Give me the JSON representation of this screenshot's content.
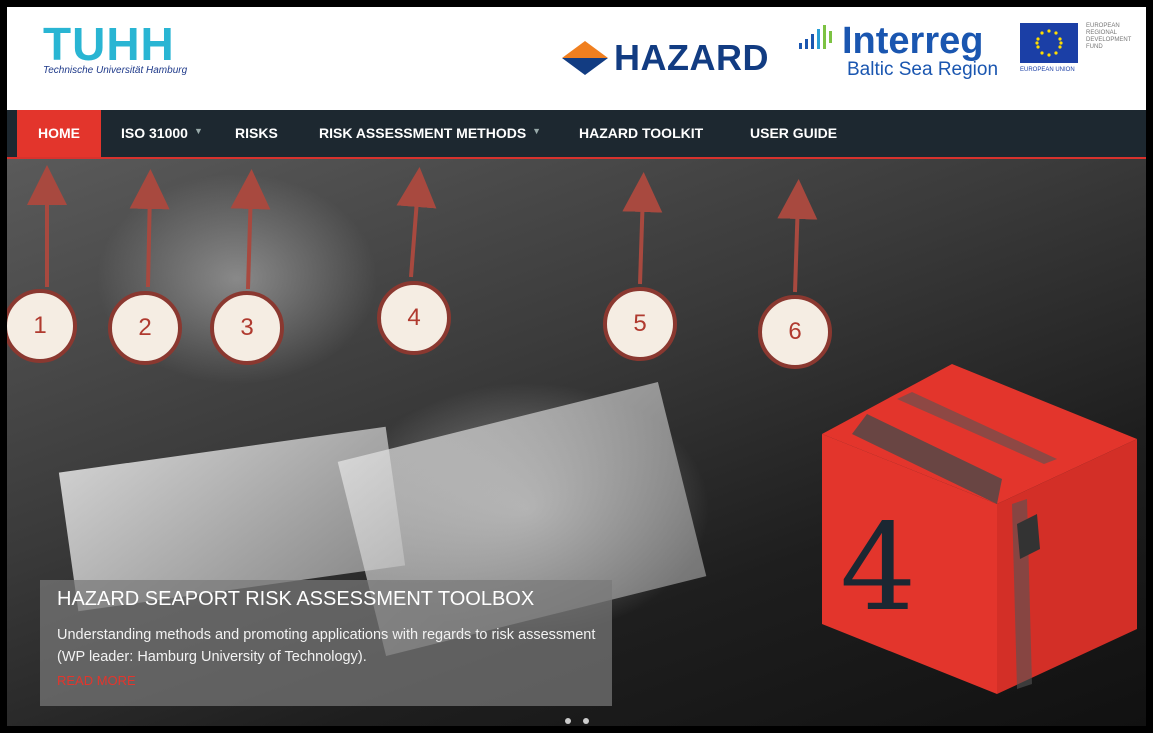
{
  "header": {
    "tuhh_logo": "TUHH",
    "tuhh_subtitle": "Technische Universität Hamburg",
    "hazard_logo": "HAZARD",
    "interreg_logo": "Interreg",
    "interreg_subtitle": "Baltic Sea Region",
    "eu_text": "EUROPEAN REGIONAL DEVELOPMENT FUND",
    "eu_union": "EUROPEAN UNION"
  },
  "nav": {
    "items": [
      {
        "label": "HOME",
        "active": true
      },
      {
        "label": "ISO 31000",
        "has_dropdown": true
      },
      {
        "label": "RISKS"
      },
      {
        "label": "RISK ASSESSMENT METHODS",
        "has_dropdown": true
      },
      {
        "label": "HAZARD TOOLKIT"
      },
      {
        "label": "USER GUIDE"
      }
    ]
  },
  "hero": {
    "caption_title": "HAZARD SEAPORT RISK ASSESSMENT TOOLBOX",
    "caption_desc": "Understanding methods and promoting applications with regards to risk assessment (WP leader: Hamburg University of Technology).",
    "read_more": "READ MORE",
    "box_number": "4"
  },
  "annotations": [
    "1",
    "2",
    "3",
    "4",
    "5",
    "6"
  ],
  "colors": {
    "accent_red": "#e3352c",
    "nav_bg": "#1d2830",
    "tuhh_blue": "#29b5d3",
    "hazard_blue": "#123c82",
    "interreg_blue": "#1a56b0",
    "annotation_border": "#8a3830"
  }
}
